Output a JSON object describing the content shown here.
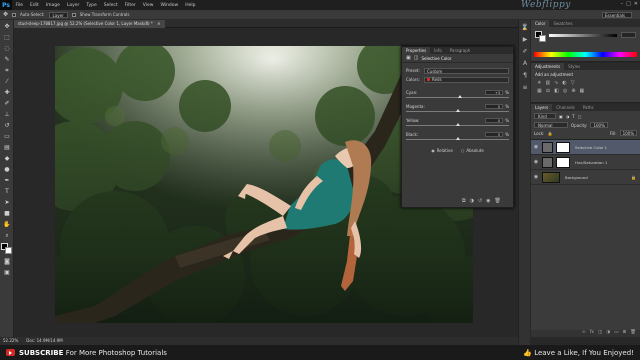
{
  "app": {
    "logo": "Ps",
    "watermark": "Webflippy"
  },
  "menu": [
    "File",
    "Edit",
    "Image",
    "Layer",
    "Type",
    "Select",
    "Filter",
    "View",
    "Window",
    "Help"
  ],
  "window_controls": [
    "–",
    "□",
    "✕"
  ],
  "options_bar": {
    "auto_select": "Auto-Select:",
    "auto_select_value": "Layer",
    "show_transform": "Show Transform Controls",
    "workspace": "Essentials"
  },
  "document": {
    "tab": "stud-sleep-178817.jpg @ 52.2% (Selective Color 1, Layer Mask/8) *",
    "zoom": "52.22%",
    "doc_size": "Doc: 14.9M/14.9M"
  },
  "properties": {
    "tabs": [
      "Properties",
      "Info",
      "Paragraph"
    ],
    "title": "Selective Color",
    "preset_label": "Preset:",
    "preset_value": "Custom",
    "colors_label": "Colors:",
    "colors_value": "Reds",
    "sliders": [
      {
        "label": "Cyan:",
        "value": "+3",
        "unit": "%",
        "level": 0.52
      },
      {
        "label": "Magenta:",
        "value": "0",
        "unit": "%",
        "level": 0.5
      },
      {
        "label": "Yellow:",
        "value": "0",
        "unit": "%",
        "level": 0.5
      },
      {
        "label": "Black:",
        "value": "0",
        "unit": "%",
        "level": 0.5
      }
    ],
    "relative": "Relative",
    "absolute": "Absolute"
  },
  "color_panel": {
    "tabs": [
      "Color",
      "Swatches"
    ]
  },
  "adjustments": {
    "tabs": [
      "Adjustments",
      "Styles"
    ],
    "title": "Add an adjustment"
  },
  "layers": {
    "tabs": [
      "Layers",
      "Channels",
      "Paths"
    ],
    "kind": "Kind",
    "blend": "Normal",
    "opacity_label": "Opacity:",
    "opacity": "100%",
    "lock_label": "Lock:",
    "fill_label": "Fill:",
    "fill": "100%",
    "items": [
      {
        "name": "Selective Color 1",
        "selected": true
      },
      {
        "name": "Hue/Saturation 1",
        "selected": false
      },
      {
        "name": "Background",
        "selected": false
      }
    ]
  },
  "footer": {
    "subscribe": "SUBSCRIBE",
    "subscribe_rest": "For More Photoshop Tutorials",
    "right": "Leave a Like, If You Enjoyed!"
  },
  "colors": {
    "accent": "#31a8ff",
    "youtube": "#d42a26",
    "dress": "#1f7a73"
  }
}
